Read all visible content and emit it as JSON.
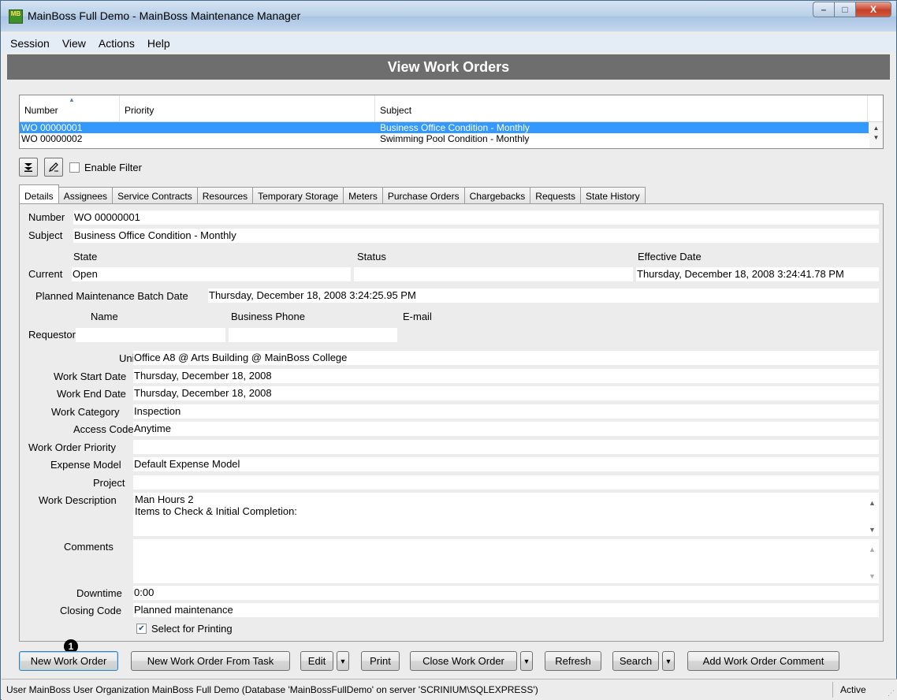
{
  "window": {
    "title": "MainBoss Full Demo - MainBoss Maintenance Manager",
    "icon_text": "MB",
    "minimize_glyph": "–",
    "maximize_glyph": "□",
    "close_glyph": "X"
  },
  "menu": [
    "Session",
    "View",
    "Actions",
    "Help"
  ],
  "page_title": "View Work Orders",
  "list": {
    "columns": [
      "Number",
      "Priority",
      "Subject"
    ],
    "rows": [
      {
        "number": "WO 00000001",
        "priority": "",
        "subject": "Business Office Condition - Monthly",
        "selected": true
      },
      {
        "number": "WO 00000002",
        "priority": "",
        "subject": "Swimming Pool Condition - Monthly",
        "selected": false
      }
    ]
  },
  "filter": {
    "enable_label": "Enable Filter",
    "enabled": false,
    "expand_icon": "double-chevron-down-icon",
    "edit_icon": "pencil-icon"
  },
  "tabs": [
    "Details",
    "Assignees",
    "Service Contracts",
    "Resources",
    "Temporary Storage",
    "Meters",
    "Purchase Orders",
    "Chargebacks",
    "Requests",
    "State History"
  ],
  "active_tab": "Details",
  "details": {
    "number_label": "Number",
    "number": "WO 00000001",
    "subject_label": "Subject",
    "subject": "Business Office Condition - Monthly",
    "state_header": "State",
    "status_header": "Status",
    "effective_date_header": "Effective Date",
    "current_label": "Current",
    "current_state": "Open",
    "current_status": "",
    "effective_date": "Thursday, December 18, 2008 3:24:41.78 PM",
    "pm_batch_label": "Planned Maintenance Batch Date",
    "pm_batch_date": "Thursday, December 18, 2008 3:24:25.95 PM",
    "name_header": "Name",
    "phone_header": "Business Phone",
    "email_header": "E-mail",
    "requestor_label": "Requestor",
    "requestor_name": "",
    "requestor_phone": "",
    "requestor_email": "",
    "unit_label": "Unit",
    "unit": "Office A8 @ Arts Building @ MainBoss College",
    "start_label": "Work Start Date",
    "start": "Thursday, December 18, 2008",
    "end_label": "Work End Date",
    "end": "Thursday, December 18, 2008",
    "category_label": "Work Category",
    "category": "Inspection",
    "access_label": "Access Code",
    "access": "Anytime",
    "priority_label": "Work Order Priority",
    "priority": "",
    "expense_label": "Expense Model",
    "expense": "Default Expense Model",
    "project_label": "Project",
    "project": "",
    "description_label": "Work Description",
    "description_line1": "Man Hours 2",
    "description_line2": "Items to Check & Initial Completion:",
    "comments_label": "Comments",
    "comments": "",
    "downtime_label": "Downtime",
    "downtime": "0:00",
    "closing_label": "Closing Code",
    "closing": "Planned maintenance",
    "print_label": "Select for Printing",
    "print_checked": true
  },
  "marker": "1",
  "buttons": {
    "new_wo": "New Work Order",
    "new_from_task": "New Work Order From Task",
    "edit": "Edit",
    "print": "Print",
    "close_wo": "Close Work Order",
    "refresh": "Refresh",
    "search": "Search",
    "add_comment": "Add Work Order Comment"
  },
  "status": {
    "text": "User MainBoss User Organization MainBoss Full Demo (Database 'MainBossFullDemo' on server 'SCRINIUM\\SQLEXPRESS')",
    "state": "Active"
  }
}
